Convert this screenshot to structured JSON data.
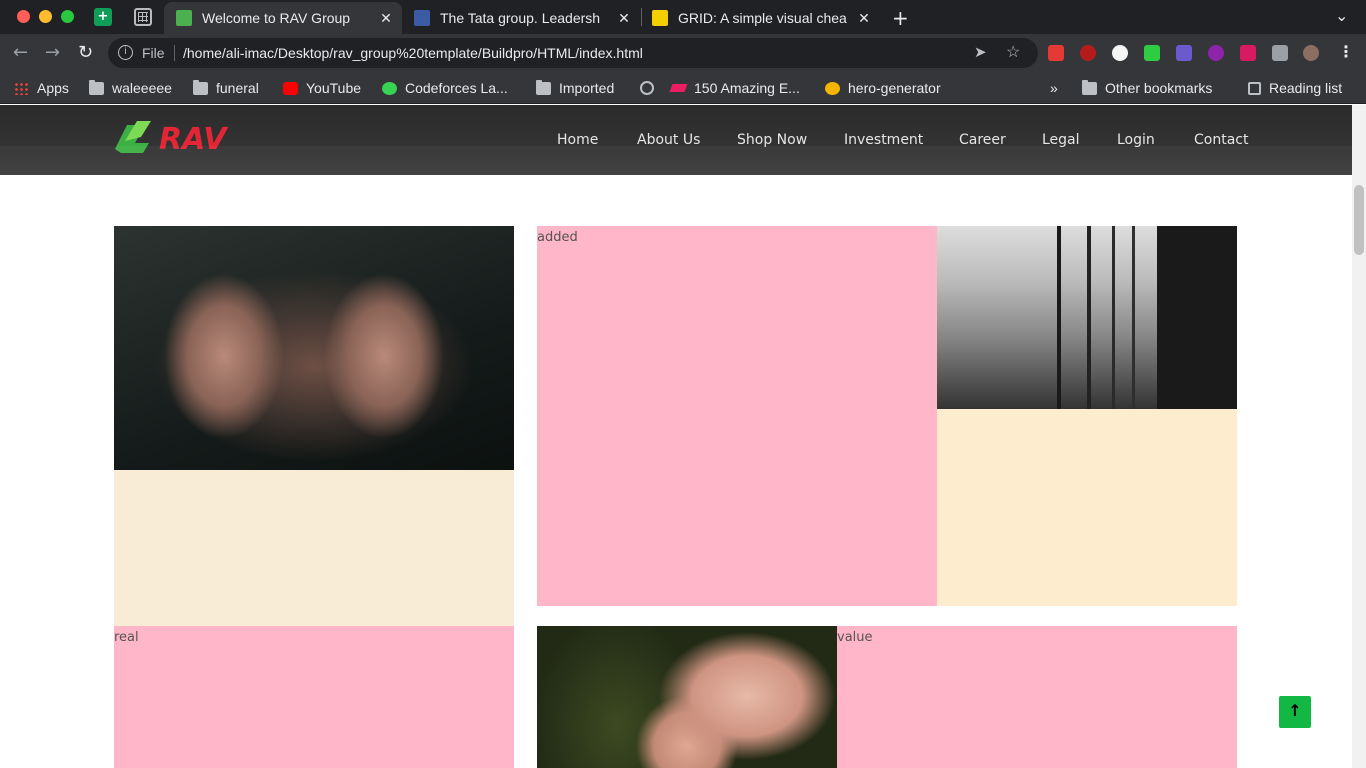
{
  "browser": {
    "tabs": [
      {
        "title": "Welcome to RAV Group",
        "active": true,
        "favicon_color": "#4caf50"
      },
      {
        "title": "The Tata group. Leadersh",
        "active": false,
        "favicon_color": "#3b5ba5"
      },
      {
        "title": "GRID: A simple visual chea",
        "active": false,
        "favicon_color": "#f5d000"
      }
    ],
    "url_scheme": "File",
    "url": "/home/ali-imac/Desktop/rav_group%20template/Buildpro/HTML/index.html",
    "bookmarks": [
      {
        "label": "Apps",
        "icon": "apps-grid-icon"
      },
      {
        "label": "waleeeee",
        "icon": "folder-icon"
      },
      {
        "label": "funeral",
        "icon": "folder-icon"
      },
      {
        "label": "YouTube",
        "icon": "youtube-icon"
      },
      {
        "label": "Codeforces La...",
        "icon": "codeforces-icon"
      },
      {
        "label": "Imported",
        "icon": "folder-icon"
      },
      {
        "label": "",
        "icon": "globe-icon"
      },
      {
        "label": "150 Amazing E...",
        "icon": "webflow-icon"
      },
      {
        "label": "hero-generator",
        "icon": "hero-icon"
      }
    ],
    "bookmarks_overflow": "»",
    "other_bookmarks": "Other bookmarks",
    "reading_list": "Reading list"
  },
  "site": {
    "logo_text": "RAV",
    "nav": [
      "Home",
      "About Us",
      "Shop Now",
      "Investment",
      "Career",
      "Legal",
      "Login",
      "Contact"
    ],
    "grid_labels": {
      "added": "added",
      "real": "real",
      "value": "value"
    },
    "back_to_top": "↑"
  },
  "colors": {
    "pink": "#ffb6c8",
    "cream_left": "#f8ecd7",
    "cream_right": "#fdeccd",
    "accent_green": "#13b844"
  }
}
